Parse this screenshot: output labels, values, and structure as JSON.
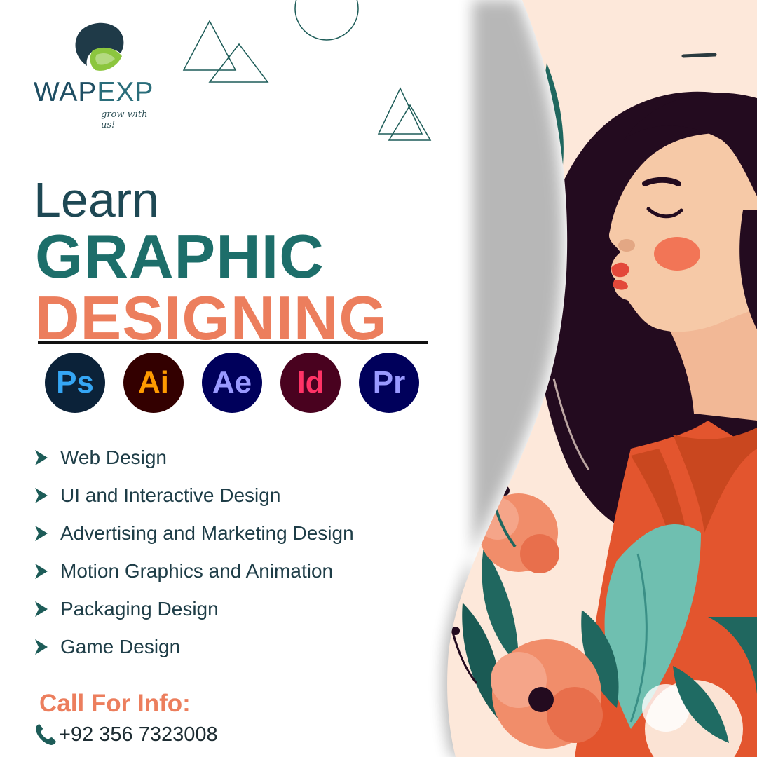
{
  "brand": {
    "name_part1": "WAP",
    "name_part2": "EXP",
    "tagline": "grow with us!"
  },
  "heading": {
    "line1": "Learn",
    "line2": "GRAPHIC",
    "line3": "DESIGNING"
  },
  "apps": [
    {
      "abbr": "Ps",
      "bg": "#0b2239",
      "fg": "#35a6f5",
      "icon": "photoshop-icon"
    },
    {
      "abbr": "Ai",
      "bg": "#330000",
      "fg": "#ff9a00",
      "icon": "illustrator-icon"
    },
    {
      "abbr": "Ae",
      "bg": "#00005b",
      "fg": "#9999ff",
      "icon": "after-effects-icon"
    },
    {
      "abbr": "Id",
      "bg": "#49021f",
      "fg": "#ff3366",
      "icon": "indesign-icon"
    },
    {
      "abbr": "Pr",
      "bg": "#00005b",
      "fg": "#9999ff",
      "icon": "premiere-icon"
    }
  ],
  "services": [
    "Web Design",
    "UI and Interactive Design",
    "Advertising and Marketing Design",
    "Motion Graphics and Animation",
    "Packaging Design",
    "Game Design"
  ],
  "contact": {
    "cta": "Call For Info:",
    "phone": "+92 356 7323008"
  },
  "colors": {
    "teal": "#1d6e6a",
    "coral": "#ec7e5d",
    "navy": "#1e3d47",
    "hair": "#230b1f",
    "skin": "#f6c9a7",
    "shirt": "#e3552e"
  }
}
